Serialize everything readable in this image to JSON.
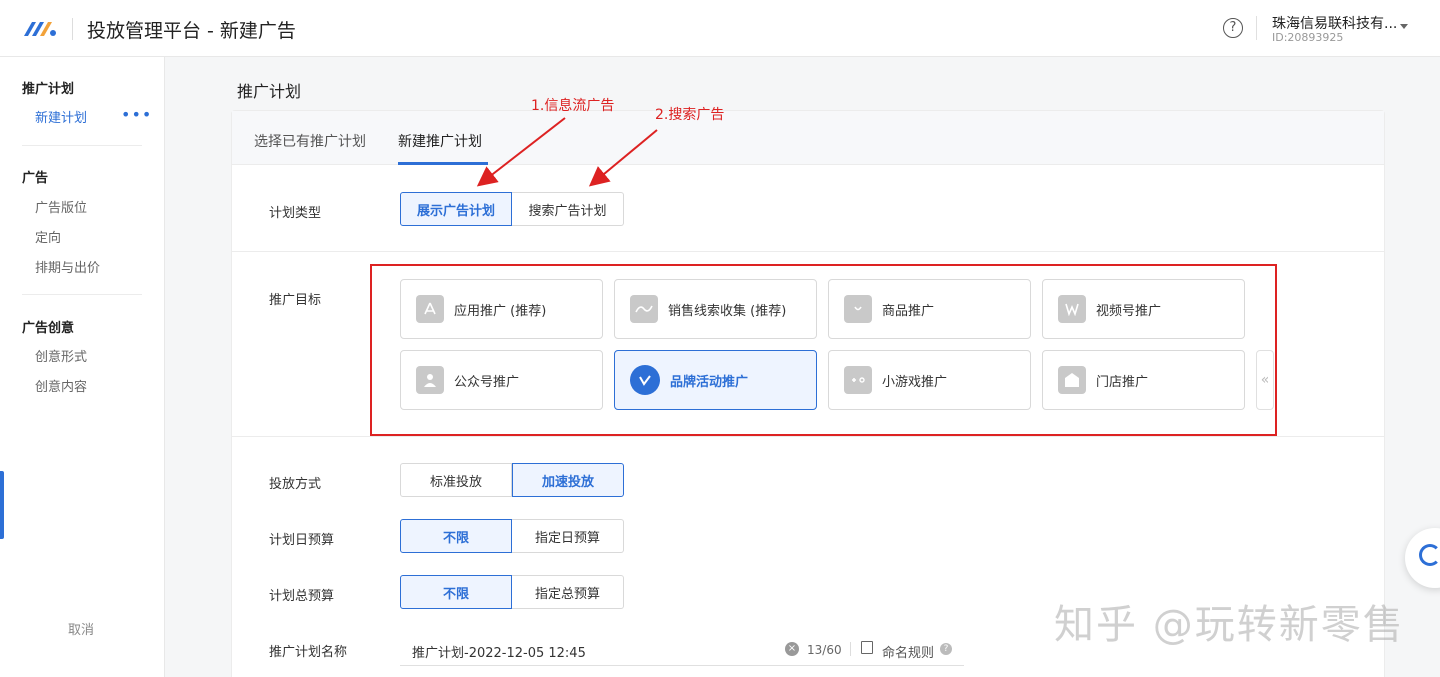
{
  "header": {
    "title": "投放管理平台 - 新建广告",
    "help_icon": "question-circle-icon",
    "company_name": "珠海信易联科技有...",
    "company_id": "ID:20893925"
  },
  "sidebar": {
    "groups": [
      {
        "label": "推广计划",
        "items": [
          "新建计划"
        ]
      },
      {
        "label": "广告",
        "items": [
          "广告版位",
          "定向",
          "排期与出价"
        ]
      },
      {
        "label": "广告创意",
        "items": [
          "创意形式",
          "创意内容"
        ]
      }
    ],
    "more": "•••",
    "cancel": "取消"
  },
  "page": {
    "title": "推广计划",
    "tabs": [
      "选择已有推广计划",
      "新建推广计划"
    ],
    "active_tab": 1
  },
  "annotations": {
    "a1": "1.信息流广告",
    "a2": "2.搜索广告"
  },
  "form": {
    "plan_type": {
      "label": "计划类型",
      "options": [
        "展示广告计划",
        "搜索广告计划"
      ],
      "selected": 0
    },
    "goal": {
      "label": "推广目标",
      "options": [
        {
          "label": "应用推广 (推荐)",
          "icon": "app-store-icon"
        },
        {
          "label": "销售线索收集 (推荐)",
          "icon": "leads-icon"
        },
        {
          "label": "商品推广",
          "icon": "shopping-bag-icon"
        },
        {
          "label": "视频号推广",
          "icon": "channels-icon"
        },
        {
          "label": "公众号推广",
          "icon": "official-account-icon"
        },
        {
          "label": "品牌活动推广",
          "icon": "brand-activity-icon"
        },
        {
          "label": "小游戏推广",
          "icon": "mini-game-icon"
        },
        {
          "label": "门店推广",
          "icon": "store-icon"
        }
      ],
      "selected": 5,
      "more": "«"
    },
    "delivery": {
      "label": "投放方式",
      "options": [
        "标准投放",
        "加速投放"
      ],
      "selected": 1
    },
    "daily_budget": {
      "label": "计划日预算",
      "options": [
        "不限",
        "指定日预算"
      ],
      "selected": 0
    },
    "total_budget": {
      "label": "计划总预算",
      "options": [
        "不限",
        "指定总预算"
      ],
      "selected": 0
    },
    "plan_name": {
      "label": "推广计划名称",
      "value": "推广计划-2022-12-05 12:45",
      "counter": "13/60",
      "rule_label": "命名规则",
      "help": "?"
    }
  },
  "watermark": "知乎 @玩转新零售",
  "colors": {
    "accent": "#2d6fd6",
    "annotation": "#dd2222"
  }
}
